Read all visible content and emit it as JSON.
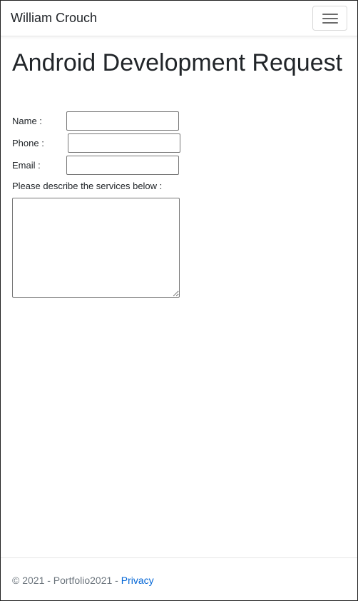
{
  "navbar": {
    "brand": "William Crouch",
    "menu_icon": "hamburger-menu-icon"
  },
  "page": {
    "title": "Android Development Request"
  },
  "form": {
    "name_label": "Name :",
    "name_value": "",
    "phone_label": "Phone :",
    "phone_value": "",
    "email_label": "Email :",
    "email_value": "",
    "services_label": "Please describe the services below :",
    "services_value": ""
  },
  "footer": {
    "copyright": "© 2021 - Portfolio2021 - ",
    "privacy_link": "Privacy"
  },
  "colors": {
    "link": "#0366d6",
    "footer_text": "#6c757d",
    "text": "#212529"
  }
}
